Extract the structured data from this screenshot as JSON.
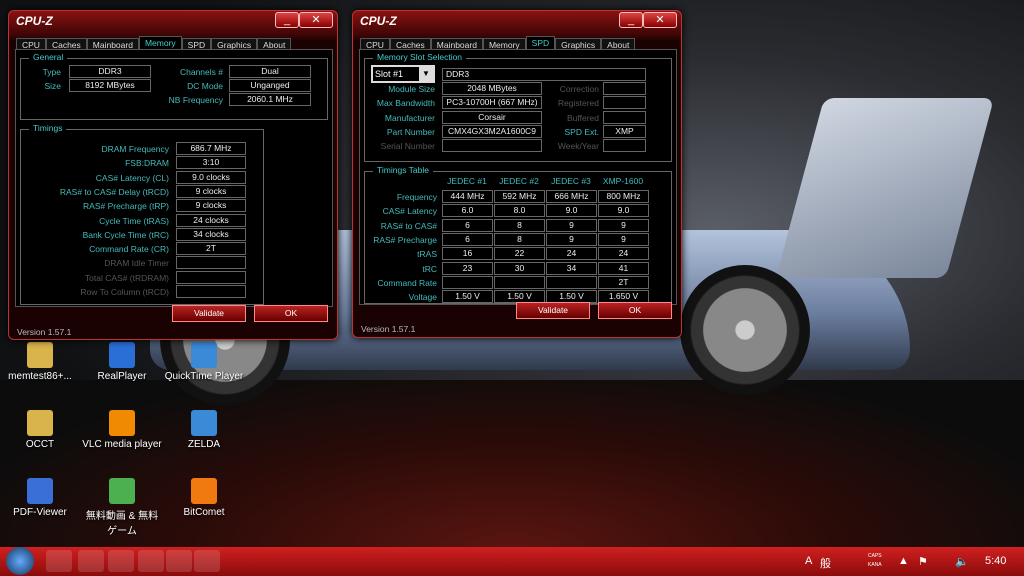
{
  "window_memory": {
    "title": "CPU-Z",
    "tabs": [
      "CPU",
      "Caches",
      "Mainboard",
      "Memory",
      "SPD",
      "Graphics",
      "About"
    ],
    "active_tab": "Memory",
    "general_title": "General",
    "general": [
      {
        "label": "Type",
        "value": "DDR3"
      },
      {
        "label": "Size",
        "value": "8192 MBytes"
      }
    ],
    "general_right": [
      {
        "label": "Channels #",
        "value": "Dual"
      },
      {
        "label": "DC Mode",
        "value": "Unganged"
      },
      {
        "label": "NB Frequency",
        "value": "2060.1 MHz"
      }
    ],
    "timings_title": "Timings",
    "timings": [
      {
        "label": "DRAM Frequency",
        "value": "686.7 MHz"
      },
      {
        "label": "FSB:DRAM",
        "value": "3:10"
      },
      {
        "label": "CAS# Latency (CL)",
        "value": "9.0 clocks"
      },
      {
        "label": "RAS# to CAS# Delay (tRCD)",
        "value": "9 clocks"
      },
      {
        "label": "RAS# Precharge (tRP)",
        "value": "9 clocks"
      },
      {
        "label": "Cycle Time (tRAS)",
        "value": "24 clocks"
      },
      {
        "label": "Bank Cycle Time (tRC)",
        "value": "34 clocks"
      },
      {
        "label": "Command Rate (CR)",
        "value": "2T"
      },
      {
        "label": "DRAM Idle Timer",
        "value": "",
        "dim": true
      },
      {
        "label": "Total CAS# (tRDRAM)",
        "value": "",
        "dim": true
      },
      {
        "label": "Row To Column (tRCD)",
        "value": "",
        "dim": true
      }
    ],
    "validate": "Validate",
    "ok": "OK",
    "version": "Version 1.57.1",
    "minimize": "_",
    "close": "✕"
  },
  "window_spd": {
    "title": "CPU-Z",
    "tabs": [
      "CPU",
      "Caches",
      "Mainboard",
      "Memory",
      "SPD",
      "Graphics",
      "About"
    ],
    "active_tab": "SPD",
    "slot_title": "Memory Slot Selection",
    "slot_value": "Slot #1",
    "mem_type": "DDR3",
    "left": [
      {
        "label": "Module Size",
        "value": "2048 MBytes"
      },
      {
        "label": "Max Bandwidth",
        "value": "PC3-10700H (667 MHz)"
      },
      {
        "label": "Manufacturer",
        "value": "Corsair"
      },
      {
        "label": "Part Number",
        "value": "CMX4GX3M2A1600C9"
      },
      {
        "label": "Serial Number",
        "value": "",
        "dim": true
      }
    ],
    "right": [
      {
        "label": "Correction",
        "value": "",
        "dim": true
      },
      {
        "label": "Registered",
        "value": "",
        "dim": true
      },
      {
        "label": "Buffered",
        "value": "",
        "dim": true
      },
      {
        "label": "SPD Ext.",
        "value": "XMP"
      },
      {
        "label": "Week/Year",
        "value": "",
        "dim": true
      }
    ],
    "table_title": "Timings Table",
    "columns": [
      "JEDEC #1",
      "JEDEC #2",
      "JEDEC #3",
      "XMP-1600"
    ],
    "rows": [
      {
        "label": "Frequency",
        "values": [
          "444 MHz",
          "592 MHz",
          "666 MHz",
          "800 MHz"
        ]
      },
      {
        "label": "CAS# Latency",
        "values": [
          "6.0",
          "8.0",
          "9.0",
          "9.0"
        ]
      },
      {
        "label": "RAS# to CAS#",
        "values": [
          "6",
          "8",
          "9",
          "9"
        ]
      },
      {
        "label": "RAS# Precharge",
        "values": [
          "6",
          "8",
          "9",
          "9"
        ]
      },
      {
        "label": "tRAS",
        "values": [
          "16",
          "22",
          "24",
          "24"
        ]
      },
      {
        "label": "tRC",
        "values": [
          "23",
          "30",
          "34",
          "41"
        ]
      },
      {
        "label": "Command Rate",
        "values": [
          "",
          "",
          "",
          "2T"
        ]
      },
      {
        "label": "Voltage",
        "values": [
          "1.50 V",
          "1.50 V",
          "1.50 V",
          "1.650 V"
        ]
      }
    ],
    "validate": "Validate",
    "ok": "OK",
    "version": "Version 1.57.1",
    "minimize": "_",
    "close": "✕"
  },
  "desktop_icons": [
    {
      "label": "memtest86+...",
      "color": "#d9b44a"
    },
    {
      "label": "RealPlayer",
      "color": "#2a6fd6"
    },
    {
      "label": "QuickTime Player",
      "color": "#3a8ad8"
    },
    {
      "label": "OCCT",
      "color": "#d9b44a"
    },
    {
      "label": "VLC media player",
      "color": "#f08a00"
    },
    {
      "label": "ZELDA",
      "color": "#3a8ad8"
    },
    {
      "label": "PDF-Viewer",
      "color": "#3a6fd8"
    },
    {
      "label": "無料動画 & 無料ゲーム",
      "color": "#4caf50"
    },
    {
      "label": "BitComet",
      "color": "#f07a10"
    }
  ],
  "taskbar": {
    "clock": "5:40",
    "tray": [
      "A",
      "般",
      "CAPS",
      "KANA"
    ]
  }
}
